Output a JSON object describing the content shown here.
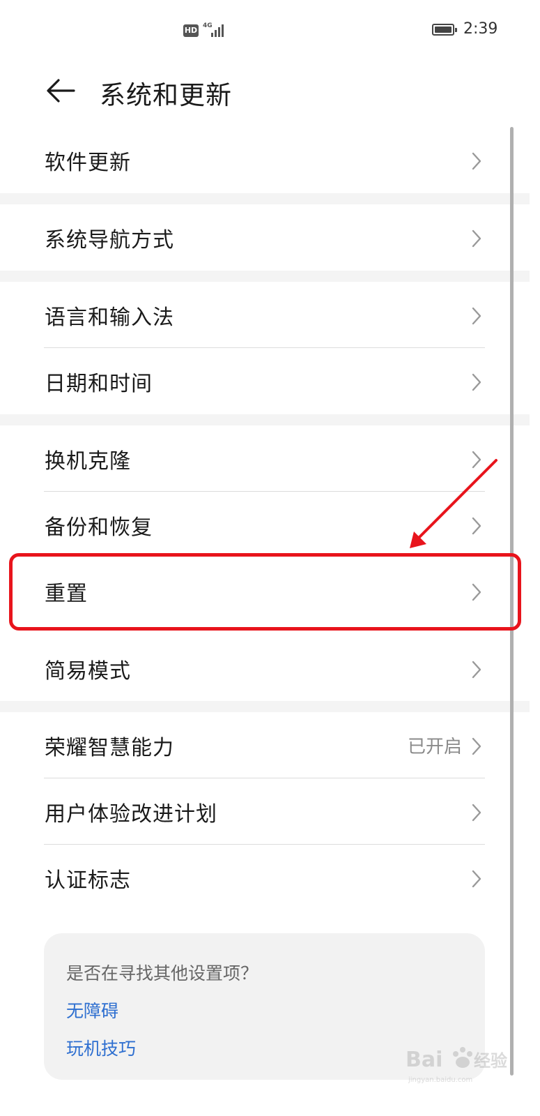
{
  "status_bar": {
    "hd": "HD",
    "network": "4G",
    "time": "2:39"
  },
  "header": {
    "title": "系统和更新"
  },
  "groups": [
    {
      "items": [
        {
          "label": "软件更新"
        }
      ]
    },
    {
      "items": [
        {
          "label": "系统导航方式"
        }
      ]
    },
    {
      "items": [
        {
          "label": "语言和输入法"
        },
        {
          "label": "日期和时间"
        }
      ]
    },
    {
      "items": [
        {
          "label": "换机克隆"
        },
        {
          "label": "备份和恢复"
        },
        {
          "label": "重置"
        },
        {
          "label": "简易模式"
        }
      ]
    },
    {
      "items": [
        {
          "label": "荣耀智慧能力",
          "value": "已开启"
        },
        {
          "label": "用户体验改进计划"
        },
        {
          "label": "认证标志"
        }
      ]
    }
  ],
  "suggestions": {
    "title": "是否在寻找其他设置项？",
    "links": [
      "无障碍",
      "玩机技巧"
    ]
  },
  "annotation": {
    "highlight_color": "#e8141c"
  },
  "watermark": {
    "text": "Bai",
    "brand": "经验",
    "url": "jingyan.baidu.com"
  },
  "colors": {
    "link": "#2e6fd0",
    "text": "#1a1a1a",
    "secondary": "#8a8a8a"
  }
}
